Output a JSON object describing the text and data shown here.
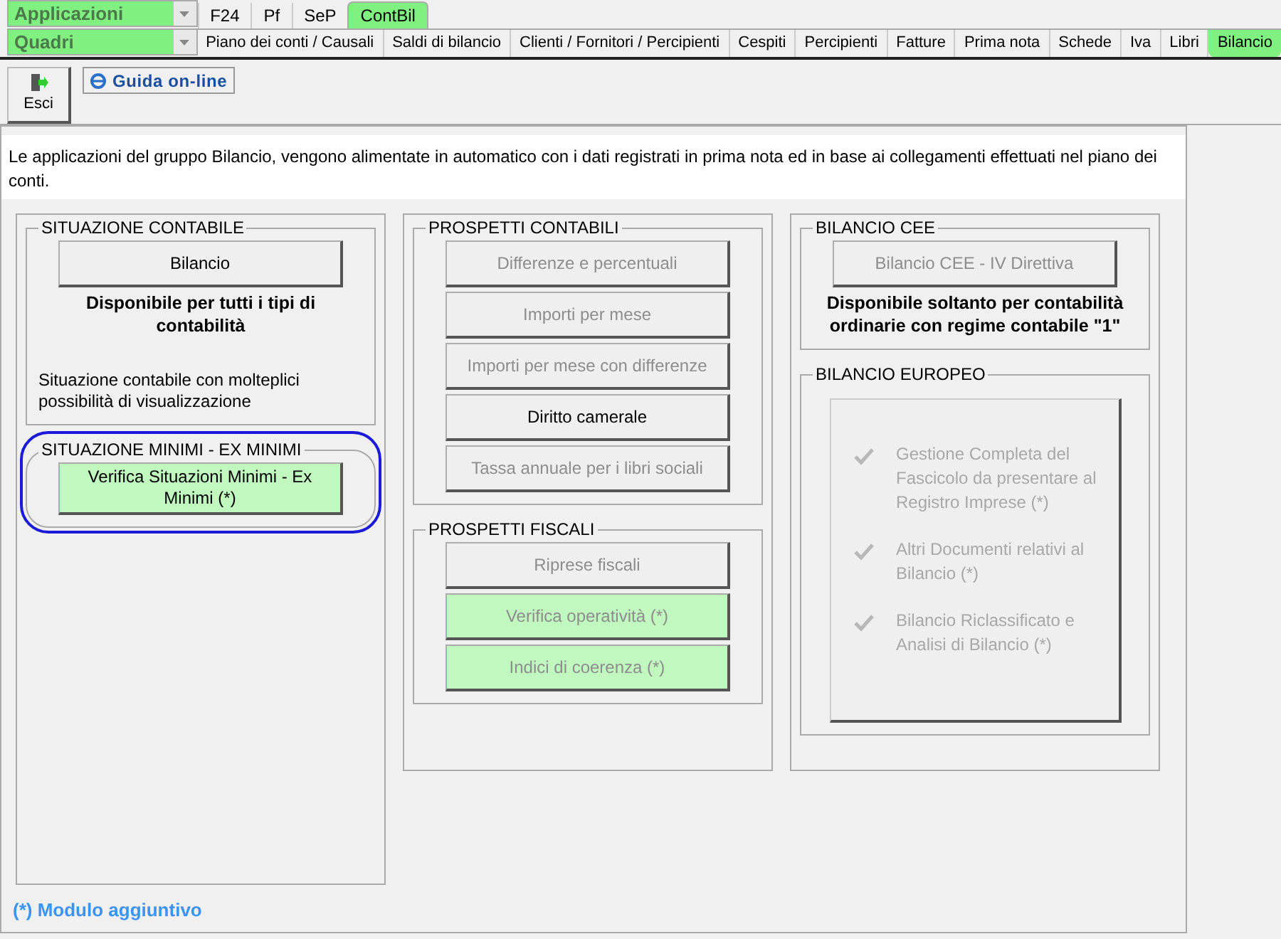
{
  "selectors": [
    {
      "value": "Applicazioni"
    },
    {
      "value": "Quadri"
    }
  ],
  "app_tabs": [
    {
      "label": "F24",
      "selected": false
    },
    {
      "label": "Pf",
      "selected": false
    },
    {
      "label": "SeP",
      "selected": false
    },
    {
      "label": "ContBil",
      "selected": true
    }
  ],
  "section_tabs": [
    {
      "label": "Piano dei conti / Causali",
      "selected": false
    },
    {
      "label": "Saldi di bilancio",
      "selected": false
    },
    {
      "label": "Clienti / Fornitori / Percipienti",
      "selected": false
    },
    {
      "label": "Cespiti",
      "selected": false
    },
    {
      "label": "Percipienti",
      "selected": false
    },
    {
      "label": "Fatture",
      "selected": false
    },
    {
      "label": "Prima nota",
      "selected": false
    },
    {
      "label": "Schede",
      "selected": false
    },
    {
      "label": "Iva",
      "selected": false
    },
    {
      "label": "Libri",
      "selected": false
    },
    {
      "label": "Bilancio",
      "selected": true
    }
  ],
  "toolbar": {
    "exit_button": "Esci",
    "help_button": "Guida on-line"
  },
  "info_text": "Le applicazioni del gruppo Bilancio, vengono alimentate in automatico con i dati registrati in prima nota ed in base ai collegamenti effettuati nel piano dei conti.",
  "columns": [
    {
      "groups": [
        {
          "title": "SITUAZIONE CONTABILE",
          "highlighted": false,
          "items": [
            {
              "kind": "button",
              "label": "Bilancio",
              "disabled": false,
              "addon": false
            },
            {
              "kind": "bold_note",
              "text": "Disponibile per tutti i tipi di contabilità"
            },
            {
              "kind": "note",
              "text": "Situazione contabile con molteplici possibilità di visualizzazione"
            }
          ]
        },
        {
          "title": "SITUAZIONE MINIMI - EX MINIMI",
          "highlighted": true,
          "items": [
            {
              "kind": "button",
              "label": "Verifica Situazioni Minimi - Ex Minimi (*)",
              "disabled": false,
              "addon": true
            }
          ]
        }
      ]
    },
    {
      "groups": [
        {
          "title": "PROSPETTI CONTABILI",
          "highlighted": false,
          "items": [
            {
              "kind": "button",
              "label": "Differenze e percentuali",
              "disabled": true,
              "addon": false
            },
            {
              "kind": "button",
              "label": "Importi per mese",
              "disabled": true,
              "addon": false
            },
            {
              "kind": "button",
              "label": "Importi per mese con differenze",
              "disabled": true,
              "addon": false
            },
            {
              "kind": "button",
              "label": "Diritto camerale",
              "disabled": false,
              "addon": false
            },
            {
              "kind": "button",
              "label": "Tassa annuale per i libri sociali",
              "disabled": true,
              "addon": false
            }
          ]
        },
        {
          "title": "PROSPETTI FISCALI",
          "highlighted": false,
          "items": [
            {
              "kind": "button",
              "label": "Riprese fiscali",
              "disabled": true,
              "addon": false
            },
            {
              "kind": "button",
              "label": "Verifica operatività (*)",
              "disabled": true,
              "addon": true
            },
            {
              "kind": "button",
              "label": "Indici di coerenza (*)",
              "disabled": true,
              "addon": true
            }
          ]
        }
      ]
    },
    {
      "groups": [
        {
          "title": "BILANCIO CEE",
          "highlighted": false,
          "items": [
            {
              "kind": "button",
              "label": "Bilancio CEE - IV Direttiva",
              "disabled": true,
              "addon": false
            },
            {
              "kind": "bold_note",
              "text": "Disponibile soltanto per contabilità ordinarie con regime contabile \"1\""
            }
          ]
        },
        {
          "title": "BILANCIO EUROPEO",
          "highlighted": false,
          "items": [
            {
              "kind": "checklist",
              "disabled": true,
              "entries": [
                "Gestione Completa del Fascicolo da presentare al Registro Imprese (*)",
                "Altri Documenti relativi al Bilancio (*)",
                "Bilancio Riclassificato e Analisi di Bilancio (*)"
              ]
            }
          ]
        }
      ]
    }
  ],
  "footnote": "(*) Modulo aggiuntivo"
}
